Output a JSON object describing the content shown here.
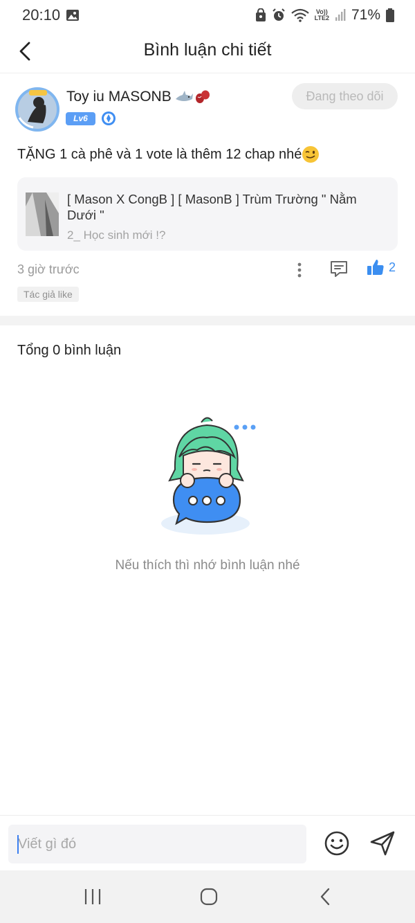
{
  "status_bar": {
    "time": "20:10",
    "battery_percent": "71%",
    "volte_line1": "Vo))",
    "volte_line2": "LTE2",
    "left_icon": "image-notification-icon",
    "right_icons": [
      "lock-icon",
      "alarm-icon",
      "wifi-icon",
      "signal-icon",
      "battery-icon"
    ]
  },
  "header": {
    "title": "Bình luận chi tiết",
    "back_icon": "chevron-left-icon"
  },
  "post": {
    "author_name": "Toy iu MASONB",
    "name_decoration_icons": [
      "shark-icon",
      "beans-icon"
    ],
    "level": "Lv6",
    "follow_label": "Đang theo dõi",
    "text": "TẶNG 1 cà phê và 1 vote là thêm 12 chap nhé",
    "text_emoji": "winking-face-icon",
    "story": {
      "title": "[ Mason X CongB ] [ MasonB ] Trùm Trường \" Nằm Dưới \"",
      "chapter": "2_ Học sinh mới !?"
    },
    "time": "3 giờ trước",
    "like_count": "2",
    "author_like_tag": "Tác giả like"
  },
  "comments": {
    "total_label": "Tổng 0 bình luận",
    "empty_text": "Nếu thích thì nhớ bình luận nhé"
  },
  "comment_bar": {
    "placeholder": "Viết gì đó"
  },
  "colors": {
    "accent": "#3b8ef0",
    "level_badge": "#5b9ef5",
    "mascot_hair": "#5fd6a4",
    "mascot_bubble": "#3f8ef2"
  }
}
